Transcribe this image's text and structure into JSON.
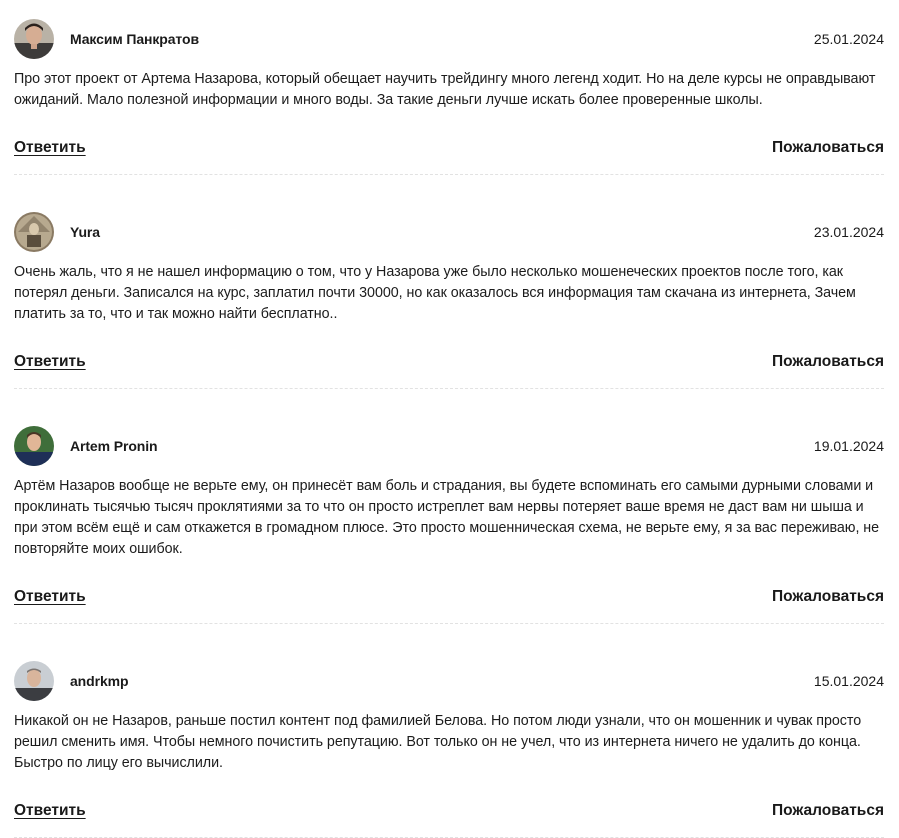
{
  "comments": [
    {
      "author": "Максим Панкратов",
      "date": "25.01.2024",
      "text": "Про этот проект от Артема Назарова, который обещает научить трейдингу много легенд ходит. Но на деле курсы не оправдывают ожиданий. Мало полезной информации и много воды. За такие деньги лучше искать более проверенные школы.",
      "reply_label": "Ответить",
      "report_label": "Пожаловаться",
      "avatar_icon": "user-avatar-photo"
    },
    {
      "author": "Yura",
      "date": "23.01.2024",
      "text": "Очень жаль, что я не нашел информацию о том, что у Назарова уже было несколько мошенеческих проектов после того, как потерял деньги. Записался на курс, заплатил почти 30000, но как оказалось вся информация там скачана из интернета, Зачем платить за то, что и так можно найти бесплатно..",
      "reply_label": "Ответить",
      "report_label": "Пожаловаться",
      "avatar_icon": "user-avatar-photo"
    },
    {
      "author": "Artem Pronin",
      "date": "19.01.2024",
      "text": "Артём Назаров вообще не верьте ему, он принесёт вам боль и страдания, вы будете вспоминать его самыми дурными словами и проклинать тысячью тысяч проклятиями за то что он просто истреплет вам нервы потеряет ваше время не даст вам ни шыша и при этом всём ещё и сам откажется в громадном плюсе. Это просто мошенническая схема, не верьте ему, я за вас переживаю, не повторяйте моих ошибок.",
      "reply_label": "Ответить",
      "report_label": "Пожаловаться",
      "avatar_icon": "user-avatar-photo"
    },
    {
      "author": "andrkmp",
      "date": "15.01.2024",
      "text": "Никакой он не Назаров, раньше постил контент под фамилией Белова. Но потом люди узнали, что он мошенник и чувак просто решил сменить имя. Чтобы немного почистить репутацию. Вот только он не учел, что из интернета ничего не удалить до конца. Быстро по лицу его вычислили.",
      "reply_label": "Ответить",
      "report_label": "Пожаловаться",
      "avatar_icon": "user-avatar-photo"
    }
  ],
  "colors": {
    "text": "#1a1a1a",
    "divider": "#e2e2e2",
    "background": "#ffffff"
  }
}
